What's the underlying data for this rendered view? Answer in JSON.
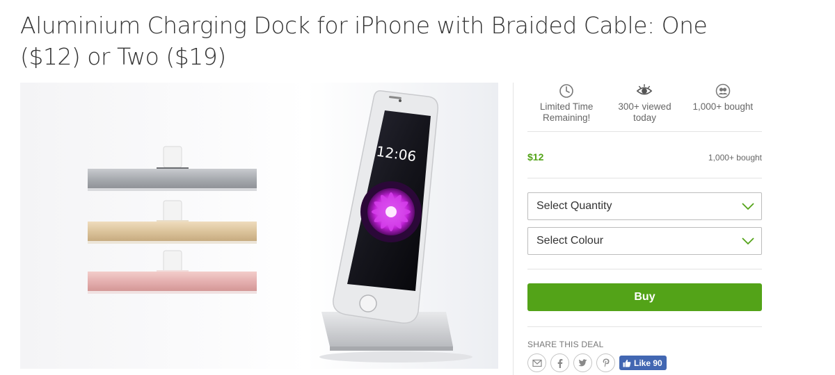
{
  "deal": {
    "title": "Aluminium Charging Dock for iPhone with Braided Cable: One ($12) or Two ($19)"
  },
  "hero": {
    "phone_time": "12:06",
    "image_subject": "aluminium-charging-docks-and-iphone"
  },
  "stats": [
    {
      "icon": "clock-icon",
      "label": "Limited Time Remaining!"
    },
    {
      "icon": "eye-icon",
      "label": "300+ viewed today"
    },
    {
      "icon": "people-icon",
      "label": "1,000+ bought"
    }
  ],
  "pricing": {
    "price": "$12",
    "bought": "1,000+ bought"
  },
  "options": {
    "quantity_placeholder": "Select Quantity",
    "colour_placeholder": "Select Colour"
  },
  "actions": {
    "buy_label": "Buy"
  },
  "share": {
    "label": "SHARE THIS DEAL",
    "icons": [
      "email-icon",
      "facebook-icon",
      "twitter-icon",
      "pinterest-icon"
    ],
    "like_label": "Like 90"
  },
  "colors": {
    "accent_green": "#53a318",
    "facebook_blue": "#4267b2",
    "dock_silver": "#a9acb1",
    "dock_gold": "#dcc49c",
    "dock_rose": "#e5b0b0"
  }
}
